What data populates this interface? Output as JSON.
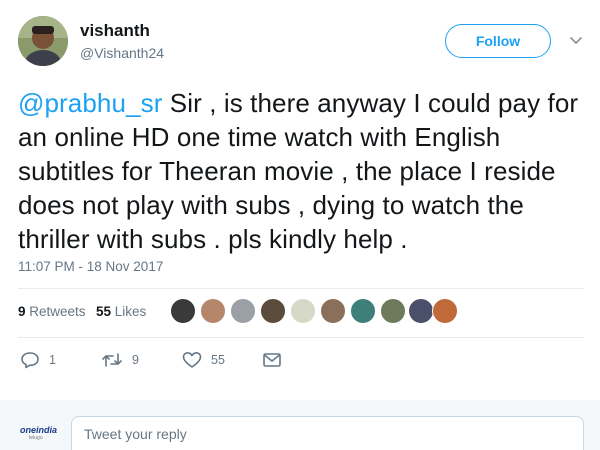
{
  "user": {
    "display_name": "vishanth",
    "handle": "@Vishanth24"
  },
  "header": {
    "follow_label": "Follow"
  },
  "tweet": {
    "mention": "@prabhu_sr",
    "body": " Sir , is there anyway I could pay for an online HD one time watch with English subtitles for Theeran movie , the place I reside does not play with subs , dying to watch the thriller with subs . pls kindly help .",
    "timestamp": "11:07 PM - 18 Nov 2017"
  },
  "stats": {
    "retweets_count": "9",
    "retweets_label": "Retweets",
    "likes_count": "55",
    "likes_label": "Likes",
    "liker_avatar_count": 10
  },
  "actions": {
    "reply_count": "1",
    "retweet_count": "9",
    "like_count": "55"
  },
  "reply": {
    "placeholder": "Tweet your reply",
    "logo_text": "oneindia",
    "logo_sub": "telugu"
  },
  "colors": {
    "accent": "#1da1f2",
    "muted": "#657786",
    "text": "#14171a"
  }
}
